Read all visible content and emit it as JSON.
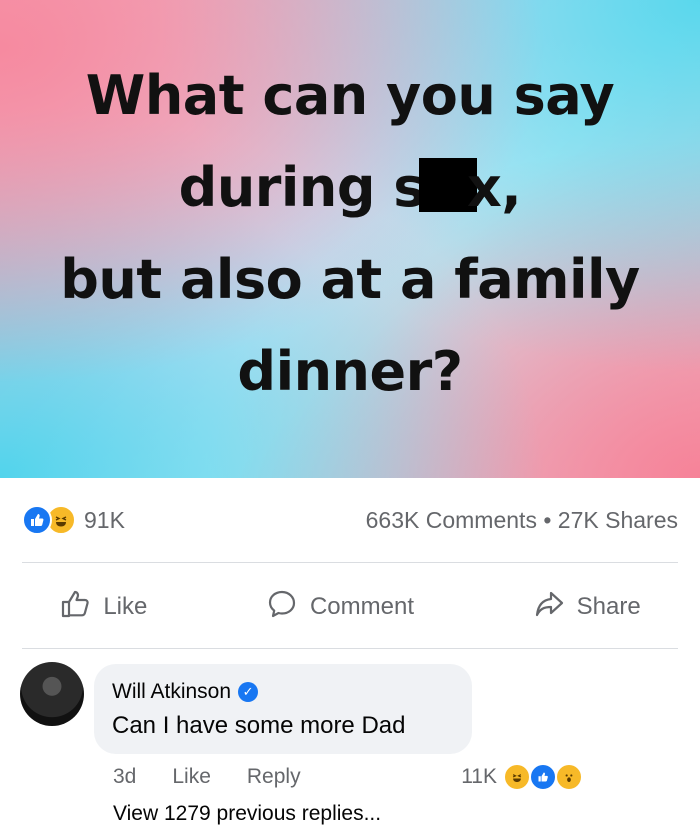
{
  "post": {
    "headline_part1": "What can you say during s",
    "headline_part2": "x,",
    "headline_part3": "but also at a family dinner?"
  },
  "stats": {
    "reaction_count": "91K",
    "comments": "663K Comments",
    "separator": "•",
    "shares": "27K Shares",
    "reaction_icons": [
      "like-icon",
      "haha-icon"
    ]
  },
  "actions": {
    "like": "Like",
    "comment": "Comment",
    "share": "Share"
  },
  "comment": {
    "author": "Will Atkinson",
    "verified": true,
    "text": "Can I have some more Dad",
    "age": "3d",
    "like": "Like",
    "reply": "Reply",
    "reaction_count": "11K",
    "reaction_icons": [
      "haha-icon",
      "like-icon",
      "wow-icon"
    ]
  },
  "replies": {
    "view_previous": "View 1279 previous replies..."
  },
  "colors": {
    "facebook_blue": "#1877f2",
    "muted_text": "#65676b",
    "bubble_bg": "#f0f2f5"
  }
}
